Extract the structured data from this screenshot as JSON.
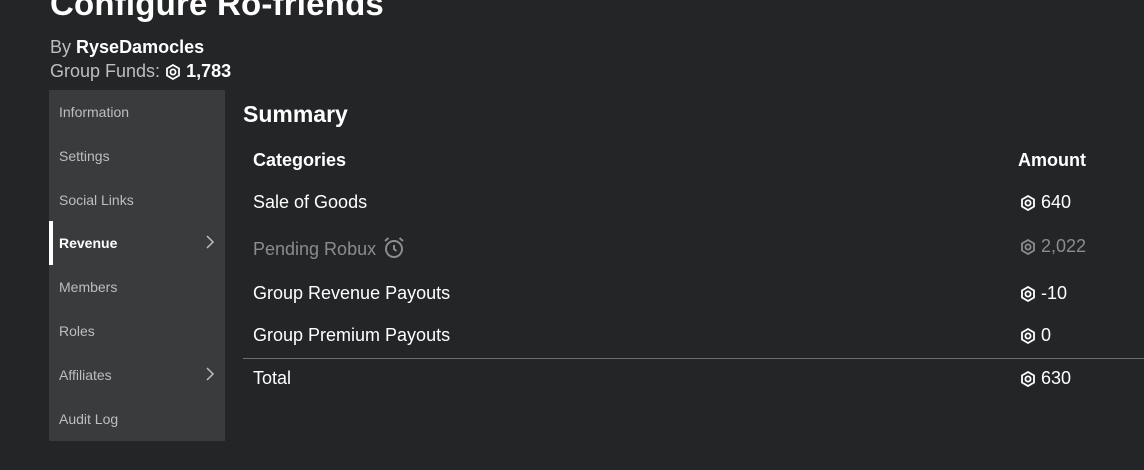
{
  "page": {
    "title": "Configure Ro-friends",
    "by_label": "By",
    "owner": "RyseDamocles",
    "funds_label": "Group Funds:",
    "funds_value": "1,783"
  },
  "sidebar": {
    "items": [
      {
        "label": "Information"
      },
      {
        "label": "Settings"
      },
      {
        "label": "Social Links"
      },
      {
        "label": "Revenue",
        "active": true,
        "has_chevron": true
      },
      {
        "label": "Members"
      },
      {
        "label": "Roles"
      },
      {
        "label": "Affiliates",
        "has_chevron": true
      },
      {
        "label": "Audit Log"
      }
    ]
  },
  "summary": {
    "title": "Summary",
    "columns": {
      "category": "Categories",
      "amount": "Amount"
    },
    "rows": [
      {
        "category": "Sale of Goods",
        "amount": "640"
      },
      {
        "category": "Pending Robux",
        "amount": "2,022",
        "pending": true,
        "icon": "alarm-clock-icon"
      },
      {
        "category": "Group Revenue Payouts",
        "amount": "-10"
      },
      {
        "category": "Group Premium Payouts",
        "amount": "0"
      }
    ],
    "total": {
      "category": "Total",
      "amount": "630"
    }
  },
  "icons": {
    "currency": "robux-icon",
    "chevron": "chevron-right-icon"
  },
  "colors": {
    "background": "#232527",
    "sidebar": "#393b3d",
    "muted": "#bdbebe",
    "pending": "#8a8c8e"
  }
}
